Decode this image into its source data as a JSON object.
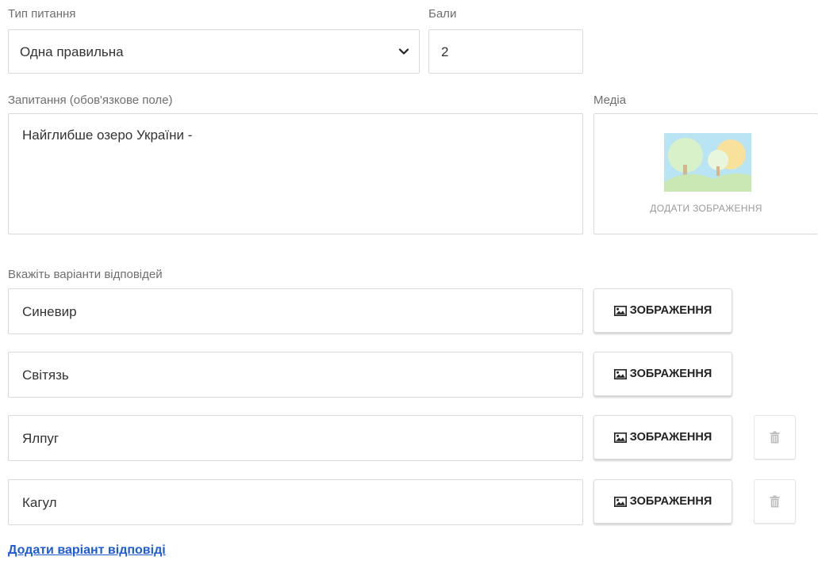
{
  "type_field": {
    "label": "Тип питання",
    "value": "Одна правильна"
  },
  "score_field": {
    "label": "Бали",
    "value": "2"
  },
  "question_field": {
    "label": "Запитання (обов'язкове поле)",
    "value": "Найглибше озеро України -"
  },
  "media": {
    "label": "Медіа",
    "caption": "ДОДАТИ ЗОБРАЖЕННЯ",
    "icon": "landscape-image-placeholder-icon"
  },
  "answers_label": "Вкажіть варіанти відповідей",
  "answers": [
    {
      "text": "Синевир",
      "image_button": "ЗОБРАЖЕННЯ",
      "deletable": false
    },
    {
      "text": "Світязь",
      "image_button": "ЗОБРАЖЕННЯ",
      "deletable": false
    },
    {
      "text": "Ялпуг",
      "image_button": "ЗОБРАЖЕННЯ",
      "deletable": true
    },
    {
      "text": "Кагул",
      "image_button": "ЗОБРАЖЕННЯ",
      "deletable": true
    }
  ],
  "add_answer_link": "Додати варіант відповіді",
  "icons": {
    "image_button": "image-icon",
    "delete": "trash-icon",
    "select": "chevron-down-icon"
  },
  "colors": {
    "link": "#1e5bd6",
    "border": "#d9d9d9",
    "label": "#6f6f6f"
  }
}
